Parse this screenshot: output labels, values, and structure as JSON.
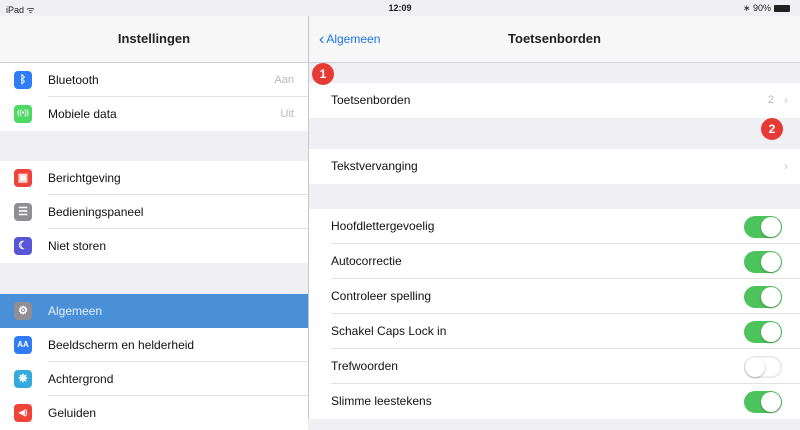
{
  "status": {
    "left": "iPad ᯤ",
    "time": "12:09",
    "right": "∗ 90%"
  },
  "master": {
    "title": "Instellingen",
    "items": [
      {
        "label": "Bluetooth",
        "value": "Aan",
        "icon": "bluetooth-icon",
        "color": "#2f7cf6",
        "glyph": "ᛒ"
      },
      {
        "label": "Mobiele data",
        "value": "Uit",
        "icon": "antenna-icon",
        "color": "#4cd964",
        "glyph": "((•))"
      },
      {
        "label": "Berichtgeving",
        "value": "",
        "icon": "notifications-icon",
        "color": "#f0433a",
        "glyph": "▣"
      },
      {
        "label": "Bedieningspaneel",
        "value": "",
        "icon": "control-center-icon",
        "color": "#8e8e93",
        "glyph": "☰"
      },
      {
        "label": "Niet storen",
        "value": "",
        "icon": "moon-icon",
        "color": "#5856d6",
        "glyph": "☾"
      },
      {
        "label": "Algemeen",
        "value": "",
        "icon": "gear-icon",
        "color": "#8e8e93",
        "glyph": "⚙"
      },
      {
        "label": "Beeldscherm en helderheid",
        "value": "",
        "icon": "display-icon",
        "color": "#2f7cf6",
        "glyph": "AA"
      },
      {
        "label": "Achtergrond",
        "value": "",
        "icon": "wallpaper-icon",
        "color": "#34aadc",
        "glyph": "❋"
      },
      {
        "label": "Geluiden",
        "value": "",
        "icon": "speaker-icon",
        "color": "#f0433a",
        "glyph": "◀)"
      }
    ]
  },
  "detail": {
    "back_label": "Algemeen",
    "title": "Toetsenborden",
    "rows": [
      {
        "label": "Toetsenborden",
        "value": "2"
      },
      {
        "label": "Tekstvervanging",
        "value": ""
      }
    ],
    "toggles": [
      {
        "label": "Hoofdlettergevoelig",
        "on": true
      },
      {
        "label": "Autocorrectie",
        "on": true
      },
      {
        "label": "Controleer spelling",
        "on": true
      },
      {
        "label": "Schakel Caps Lock in",
        "on": true
      },
      {
        "label": "Trefwoorden",
        "on": false
      },
      {
        "label": "Slimme leestekens",
        "on": true
      }
    ]
  },
  "badges": [
    "1",
    "2"
  ],
  "colors": {
    "accent": "#1a74e8",
    "selected": "#4a90d9",
    "toggle_on": "#4cc35b",
    "badge": "#e63b35"
  }
}
